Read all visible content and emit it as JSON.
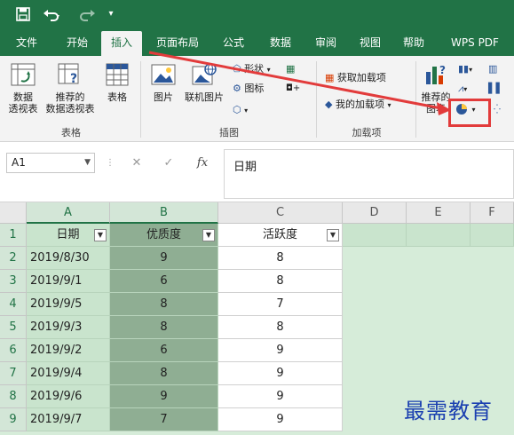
{
  "qat": {
    "save_icon": "save-icon",
    "undo_icon": "undo-icon",
    "redo_icon": "redo-icon",
    "customize_icon": "customize-qat-icon"
  },
  "tabs": [
    {
      "label": "文件"
    },
    {
      "label": "开始"
    },
    {
      "label": "插入"
    },
    {
      "label": "页面布局"
    },
    {
      "label": "公式"
    },
    {
      "label": "数据"
    },
    {
      "label": "审阅"
    },
    {
      "label": "视图"
    },
    {
      "label": "帮助"
    },
    {
      "label": "WPS PDF"
    }
  ],
  "active_tab": "插入",
  "ribbon": {
    "tables_group": {
      "label": "表格",
      "pivot": "数据\n透视表",
      "pivot_l1": "数据",
      "pivot_l2": "透视表",
      "rec_pivot_l1": "推荐的",
      "rec_pivot_l2": "数据透视表",
      "table": "表格"
    },
    "illustrations_group": {
      "label": "插图",
      "pictures": "图片",
      "online_pictures": "联机图片",
      "shapes": "形状",
      "icons": "图标"
    },
    "addins_group": {
      "label": "加载项",
      "get_addins": "获取加载项",
      "my_addins": "我的加载项"
    },
    "charts_group": {
      "rec_chart_l1": "推荐的",
      "rec_chart_l2": "图表"
    }
  },
  "formula_bar": {
    "name_box": "A1",
    "content": "日期"
  },
  "columns": [
    "A",
    "B",
    "C",
    "D",
    "E",
    "F"
  ],
  "rows": [
    "1",
    "2",
    "3",
    "4",
    "5",
    "6",
    "7",
    "8",
    "9"
  ],
  "headers": {
    "a": "日期",
    "b": "优质度",
    "c": "活跃度"
  },
  "data_rows": [
    {
      "date": "2019/8/30",
      "quality": "9",
      "activity": "8"
    },
    {
      "date": "2019/9/1",
      "quality": "6",
      "activity": "8"
    },
    {
      "date": "2019/9/5",
      "quality": "8",
      "activity": "7"
    },
    {
      "date": "2019/9/3",
      "quality": "8",
      "activity": "8"
    },
    {
      "date": "2019/9/2",
      "quality": "6",
      "activity": "9"
    },
    {
      "date": "2019/9/4",
      "quality": "8",
      "activity": "9"
    },
    {
      "date": "2019/9/6",
      "quality": "9",
      "activity": "9"
    },
    {
      "date": "2019/9/7",
      "quality": "7",
      "activity": "9"
    }
  ],
  "watermark": "最需教育",
  "colors": {
    "excel_green": "#217346",
    "annotation_red": "#e23b3b",
    "selection_fill": "#c9e4cd"
  }
}
